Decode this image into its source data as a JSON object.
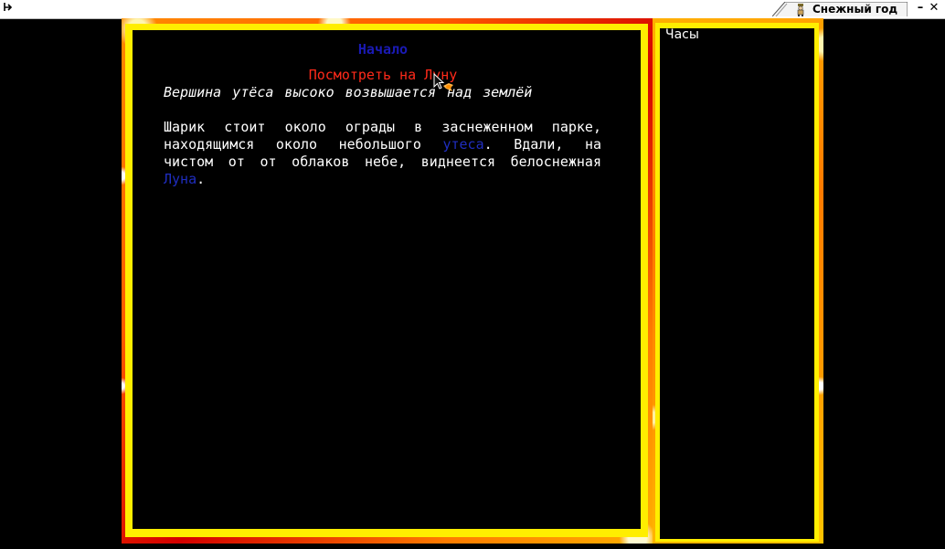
{
  "window": {
    "title": "Снежный год",
    "menu_icon": "arrow-icon",
    "minimize_label": "–",
    "close_label": "✕"
  },
  "main_panel": {
    "room_title": "Начало",
    "action_link": "Посмотреть на Луну",
    "location_description": "Вершина утёса высоко возвышается над землёй",
    "story": {
      "line1": "Шарик стоит около ограды в заснеженном парке,",
      "line2_before": "находящимся около небольшого",
      "line2_link": "утеса",
      "line2_after": ". Вдали, на",
      "line3": "чистом от от облаков небе, виднеется белоснежная",
      "line4_link": "Луна",
      "line4_after": "."
    }
  },
  "side_panel": {
    "label": "Часы"
  },
  "colors": {
    "room_title": "#1a1ab4",
    "action_link": "#ff2a1a",
    "inline_link": "#1f2dbf",
    "frame_yellow": "#ffee00",
    "frame_orange": "#ff7a00",
    "frame_red": "#d40000"
  }
}
